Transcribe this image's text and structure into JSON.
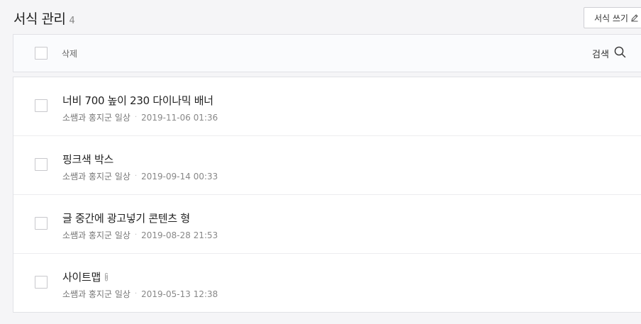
{
  "header": {
    "title": "서식 관리",
    "count": "4",
    "write_label": "서식 쓰기"
  },
  "toolbar": {
    "delete_label": "삭제",
    "search_label": "검색"
  },
  "items": [
    {
      "title": "너비 700 높이 230 다이나믹 배너",
      "author": "소쌤과 홍지군 일상",
      "date": "2019-11-06 01:36",
      "attachment": false
    },
    {
      "title": "핑크색 박스",
      "author": "소쌤과 홍지군 일상",
      "date": "2019-09-14 00:33",
      "attachment": false
    },
    {
      "title": "글 중간에 광고넣기 콘텐츠 형",
      "author": "소쌤과 홍지군 일상",
      "date": "2019-08-28 21:53",
      "attachment": false
    },
    {
      "title": "사이트맵",
      "author": "소쌤과 홍지군 일상",
      "date": "2019-05-13 12:38",
      "attachment": true
    }
  ],
  "icons": {
    "write": "pencil-icon",
    "search": "search-icon",
    "attachment": "paperclip-icon"
  },
  "colors": {
    "background": "#f5f5f7",
    "border": "#e1e2e6",
    "text": "#222222",
    "meta": "#777777"
  }
}
